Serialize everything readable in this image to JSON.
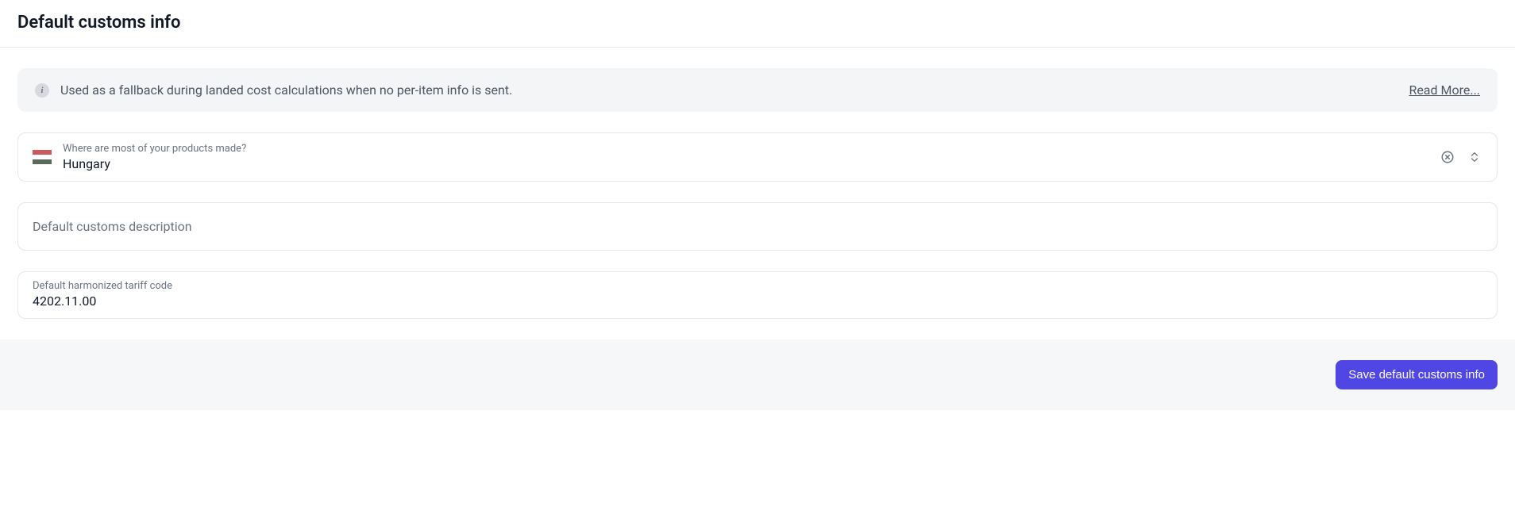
{
  "header": {
    "title": "Default customs info"
  },
  "banner": {
    "text": "Used as a fallback during landed cost calculations when no per-item info is sent.",
    "read_more": "Read More..."
  },
  "fields": {
    "country": {
      "label": "Where are most of your products made?",
      "value": "Hungary"
    },
    "description": {
      "placeholder": "Default customs description"
    },
    "tariff": {
      "label": "Default harmonized tariff code",
      "value": "4202.11.00"
    }
  },
  "footer": {
    "save_label": "Save default customs info"
  }
}
